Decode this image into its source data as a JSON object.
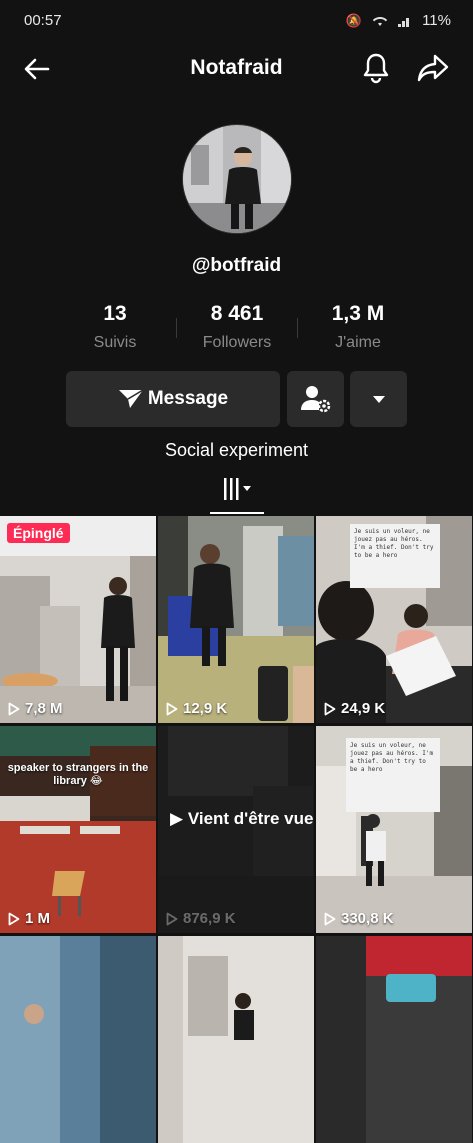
{
  "status_bar": {
    "time": "00:57",
    "battery": "11%"
  },
  "header": {
    "title": "Notafraid"
  },
  "profile": {
    "username": "@botfraid",
    "bio": "Social experiment"
  },
  "stats": [
    {
      "value": "13",
      "label": "Suivis"
    },
    {
      "value": "8 461",
      "label": "Followers"
    },
    {
      "value": "1,3 M",
      "label": "J'aime"
    }
  ],
  "actions": {
    "message_label": "Message"
  },
  "icons": {
    "back": "arrow-left-icon",
    "bell": "bell-icon",
    "share": "share-icon",
    "message": "paper-plane-icon",
    "add_user": "user-settings-icon",
    "more": "caret-down-icon",
    "grid": "grid-icon"
  },
  "colors": {
    "accent": "#fe2c55",
    "background": "#121212",
    "button": "#2b2b2b"
  },
  "videos": [
    {
      "views": "7,8 M",
      "pinned_label": "Épinglé"
    },
    {
      "views": "12,9 K"
    },
    {
      "views": "24,9 K",
      "note": "Je suis un voleur, ne jouez pas au héros. I'm a thief. Don't try to be a hero"
    },
    {
      "views": "1 M",
      "caption": "speaker to strangers in the library 😂"
    },
    {
      "views": "876,9 K",
      "overlay": "Vient d'être vue"
    },
    {
      "views": "330,8 K",
      "note": "Je suis un voleur, ne jouez pas au héros. I'm a thief. Don't try to be a hero"
    },
    {},
    {},
    {}
  ]
}
